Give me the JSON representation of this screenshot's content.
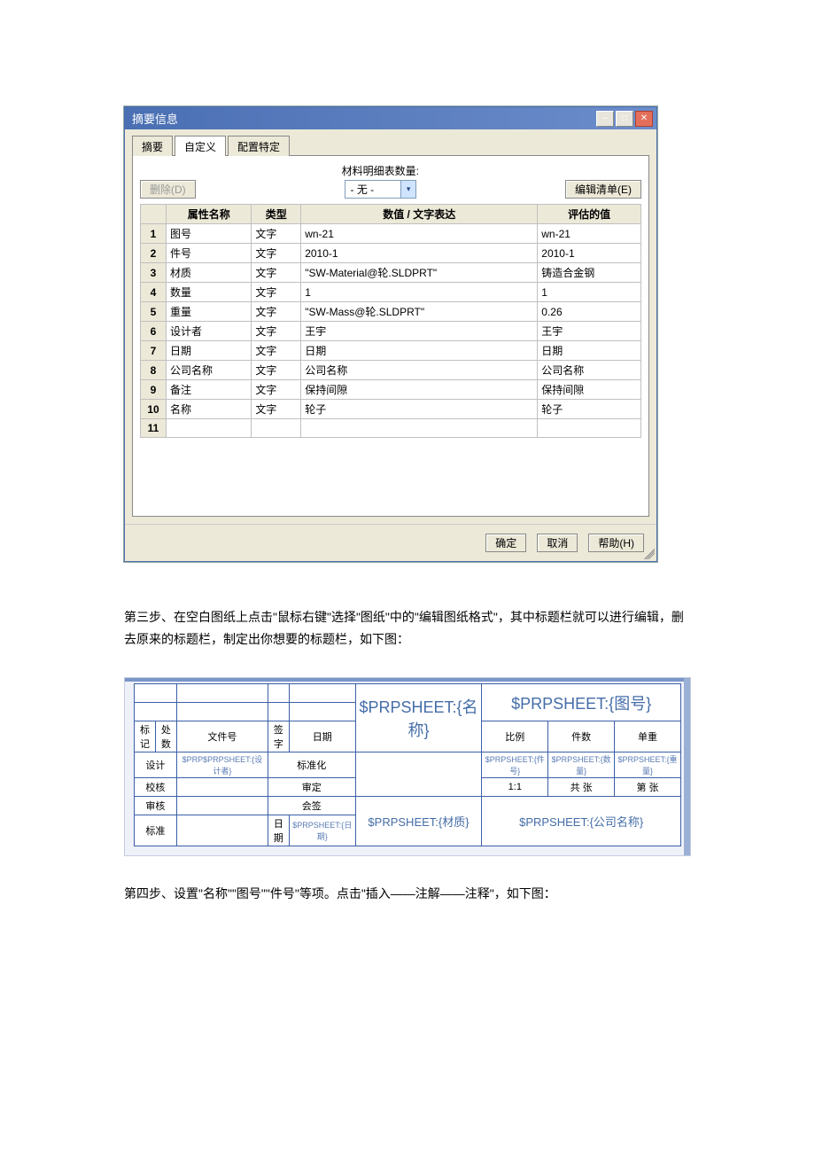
{
  "dialog": {
    "title": "摘要信息",
    "tabs": {
      "summary": "摘要",
      "custom": "自定义",
      "config": "配置特定"
    },
    "delete_btn": "删除(D)",
    "bom_label": "材料明细表数量:",
    "bom_value": "- 无 -",
    "edit_list_btn": "编辑清单(E)",
    "headers": {
      "name": "属性名称",
      "type": "类型",
      "expr": "数值 / 文字表达",
      "eval": "评估的值"
    },
    "rows": [
      {
        "n": "1",
        "name": "图号",
        "type": "文字",
        "expr": "wn-21",
        "eval": "wn-21"
      },
      {
        "n": "2",
        "name": "件号",
        "type": "文字",
        "expr": "2010-1",
        "eval": "2010-1"
      },
      {
        "n": "3",
        "name": "材质",
        "type": "文字",
        "expr": "\"SW-Material@轮.SLDPRT\"",
        "eval": "铸造合金钢"
      },
      {
        "n": "4",
        "name": "数量",
        "type": "文字",
        "expr": "1",
        "eval": "1"
      },
      {
        "n": "5",
        "name": "重量",
        "type": "文字",
        "expr": "\"SW-Mass@轮.SLDPRT\"",
        "eval": "0.26"
      },
      {
        "n": "6",
        "name": "设计者",
        "type": "文字",
        "expr": "王宇",
        "eval": "王宇"
      },
      {
        "n": "7",
        "name": "日期",
        "type": "文字",
        "expr": "日期",
        "eval": "日期"
      },
      {
        "n": "8",
        "name": "公司名称",
        "type": "文字",
        "expr": "公司名称",
        "eval": "公司名称"
      },
      {
        "n": "9",
        "name": "备注",
        "type": "文字",
        "expr": "保持间隙",
        "eval": "保持间隙"
      },
      {
        "n": "10",
        "name": "名称",
        "type": "文字",
        "expr": "轮子",
        "eval": "轮子"
      },
      {
        "n": "11",
        "name": "",
        "type": "",
        "expr": "",
        "eval": ""
      }
    ],
    "buttons": {
      "ok": "确定",
      "cancel": "取消",
      "help": "帮助(H)"
    }
  },
  "para3": "第三步、在空白图纸上点击\"鼠标右键\"选择\"图纸\"中的\"编辑图纸格式\"，其中标题栏就可以进行编辑，删去原来的标题栏，制定出你想要的标题栏，如下图：",
  "titleblock": {
    "name_expr": "$PRPSHEET:{名称}",
    "drawno_expr": "$PRPSHEET:{图号}",
    "mark": "标记",
    "proc": "处数",
    "doc": "文件号",
    "sign": "签字",
    "date": "日期",
    "design": "设计",
    "designer_expr": "$PRP$PRPSHEET:{设计者}",
    "stdchk": "标准化",
    "check": "校核",
    "approve": "审定",
    "review": "审核",
    "countersign": "会签",
    "standard": "标准",
    "date2": "日期",
    "date_expr": "$PRPSHEET:{日期}",
    "material_expr": "$PRPSHEET:{材质}",
    "company_expr": "$PRPSHEET:{公司名称}",
    "scale_lbl": "比例",
    "count_lbl": "件数",
    "weight_lbl": "单重",
    "partno_expr": "$PRPSHEET:{件号}",
    "qty_expr": "$PRPSHEET:{数量}",
    "mass_expr": "$PRPSHEET:{重量}",
    "scale_val": "1:1",
    "total": "共  张",
    "page": "第  张"
  },
  "para4": "第四步、设置\"名称\"\"图号\"\"件号\"等项。点击\"插入——注解——注释\"，如下图："
}
